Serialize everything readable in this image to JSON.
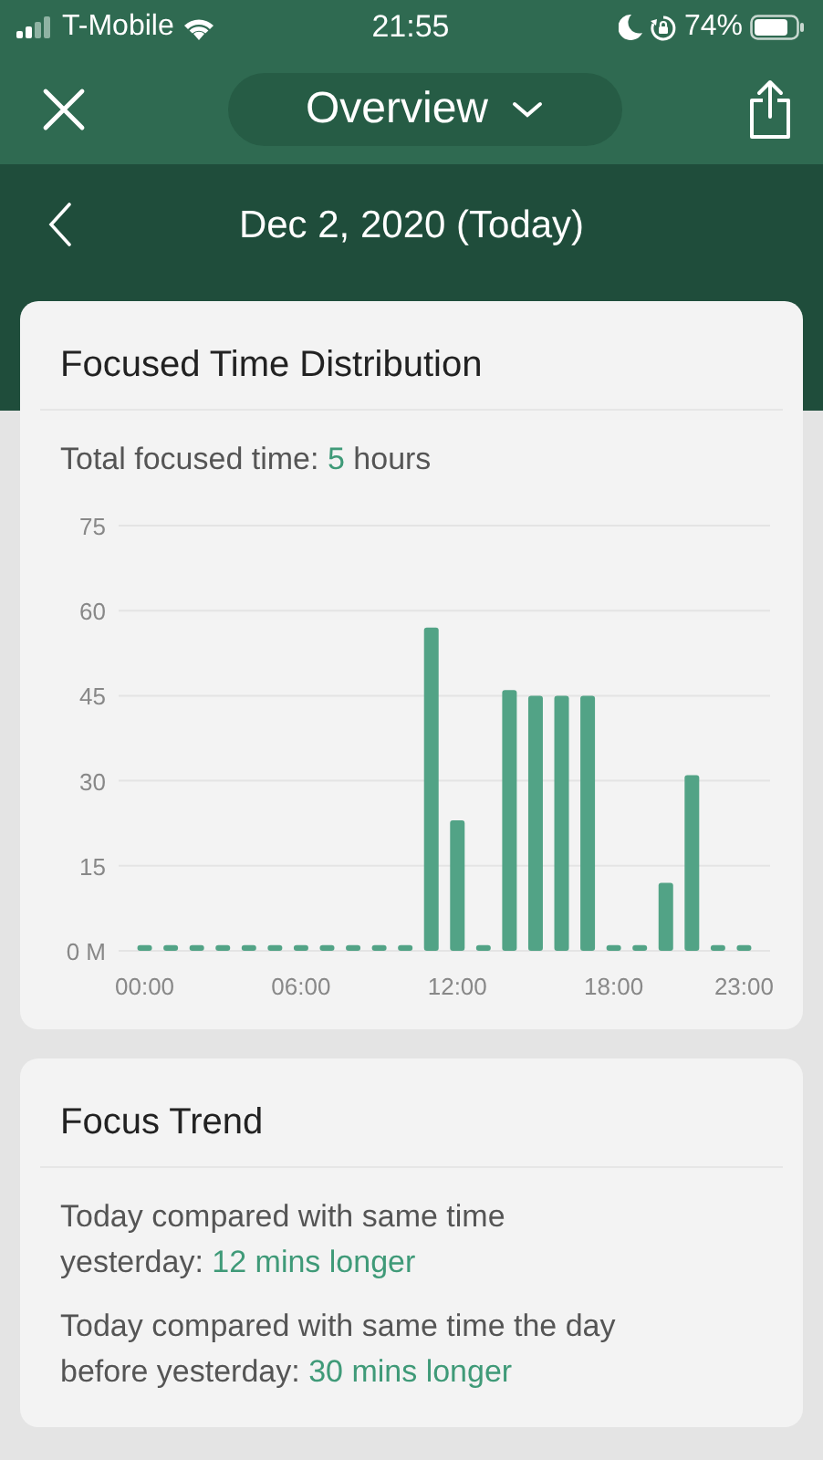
{
  "status_bar": {
    "carrier": "T-Mobile",
    "time": "21:55",
    "battery": "74%"
  },
  "header": {
    "title": "Overview"
  },
  "date_bar": {
    "date": "Dec 2, 2020 (Today)"
  },
  "distribution_card": {
    "title": "Focused Time Distribution",
    "total": {
      "label": "Total focused time:",
      "value": "5",
      "unit": "hours"
    },
    "chart_data": {
      "type": "bar",
      "x": [
        0,
        1,
        2,
        3,
        4,
        5,
        6,
        7,
        8,
        9,
        10,
        11,
        12,
        13,
        14,
        15,
        16,
        17,
        18,
        19,
        20,
        21,
        22,
        23
      ],
      "grid": true,
      "xlim": [
        -1,
        24
      ],
      "series": [
        {
          "color": "#52a386",
          "values": [
            1,
            1,
            1,
            1,
            1,
            1,
            1,
            1,
            1,
            1,
            1,
            57,
            23,
            1,
            46,
            45,
            45,
            45,
            1,
            1,
            12,
            31,
            1,
            1
          ]
        }
      ],
      "ylim": [
        0,
        75
      ],
      "yticks": [
        {
          "value": 0,
          "label": "0 M"
        },
        15,
        30,
        45,
        60,
        75
      ],
      "xticks": [
        {
          "value": 0,
          "label": "00:00"
        },
        {
          "value": 6,
          "label": "06:00"
        },
        {
          "value": 12,
          "label": "12:00"
        },
        {
          "value": 18,
          "label": "18:00"
        },
        {
          "value": 23,
          "label": "23:00"
        }
      ]
    }
  },
  "trend_card": {
    "title": "Focus Trend",
    "items": [
      {
        "text": "Today compared with same time yesterday:",
        "value": "12 mins longer"
      },
      {
        "text": "Today compared with same time the day before yesterday:",
        "value": "30 mins longer"
      }
    ]
  }
}
